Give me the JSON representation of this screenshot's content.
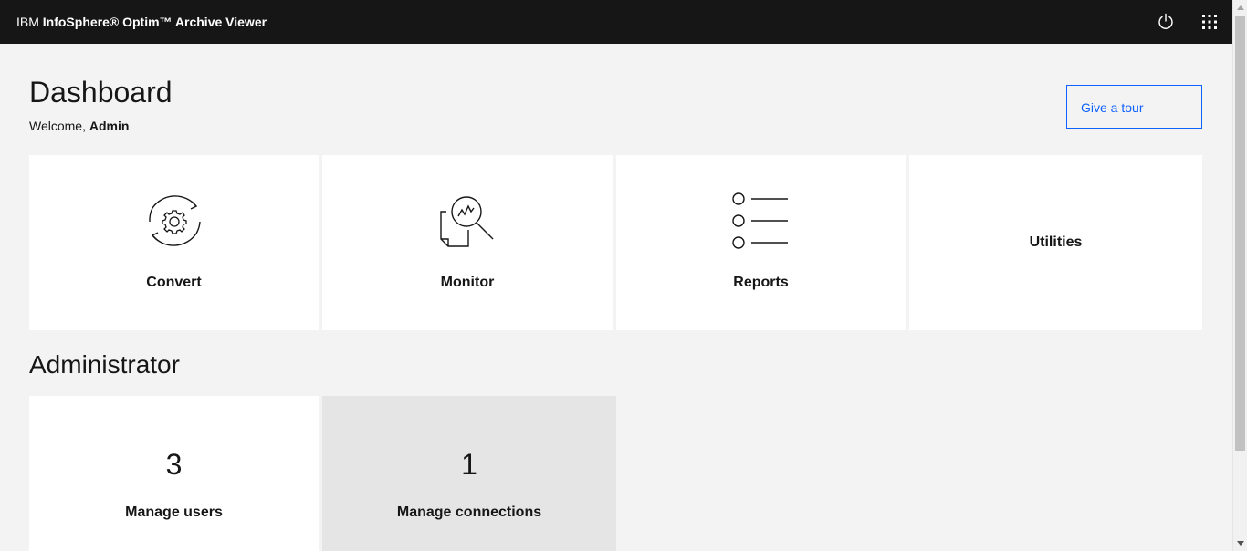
{
  "header": {
    "brand_prefix": "IBM",
    "brand_product": "InfoSphere® Optim™ Archive Viewer",
    "icons": [
      "power-icon",
      "app-switcher-icon"
    ]
  },
  "page": {
    "title": "Dashboard",
    "welcome_prefix": "Welcome,",
    "welcome_user": "Admin",
    "tour_button": "Give a tour"
  },
  "tiles": [
    {
      "label": "Convert",
      "icon": "convert-gear-cycle-icon"
    },
    {
      "label": "Monitor",
      "icon": "monitor-magnifier-icon"
    },
    {
      "label": "Reports",
      "icon": "list-icon"
    },
    {
      "label": "Utilities"
    }
  ],
  "admin": {
    "title": "Administrator",
    "tiles": [
      {
        "count": "3",
        "label": "Manage users"
      },
      {
        "count": "1",
        "label": "Manage connections"
      }
    ]
  },
  "colors": {
    "header_bg": "#161616",
    "page_bg": "#f3f3f3",
    "accent": "#0f62fe",
    "tile_bg": "#ffffff",
    "tile_hover_bg": "#e5e5e5"
  }
}
